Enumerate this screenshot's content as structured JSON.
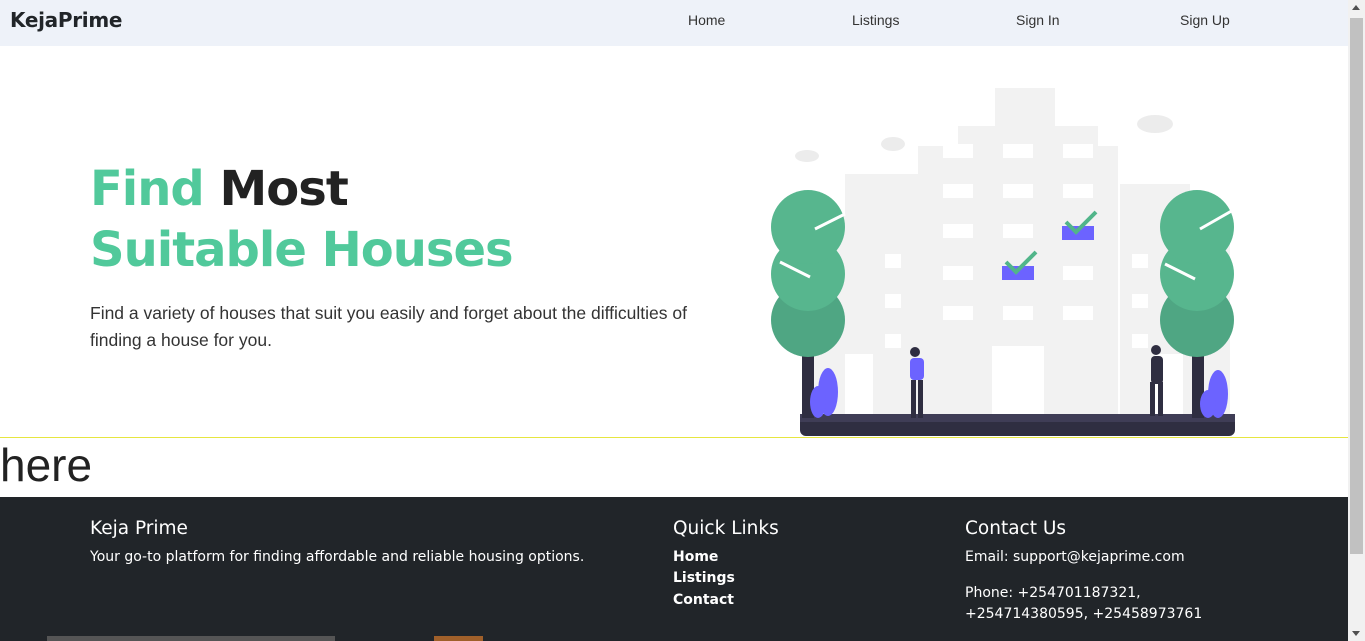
{
  "navbar": {
    "brand": "KejaPrime",
    "links": [
      "Home",
      "Listings",
      "Sign In",
      "Sign Up"
    ]
  },
  "hero": {
    "title_word1": "Find",
    "title_word2": "Most",
    "title_line2": "Suitable Houses",
    "description": "Find a variety of houses that suit you easily and forget about the difficulties of finding a house for you."
  },
  "filler_text": "here",
  "footer": {
    "about_title": "Keja Prime",
    "about_text": "Your go-to platform for finding affordable and reliable housing options.",
    "quick_links_title": "Quick Links",
    "quick_links": [
      "Home",
      "Listings",
      "Contact"
    ],
    "contact_title": "Contact Us",
    "email": "Email: support@kejaprime.com",
    "phone_line1": "Phone: +254701187321,",
    "phone_line2": "+254714380595, +25458973761"
  },
  "colors": {
    "accent_green": "#51c99b",
    "nav_bg": "#eef2f9",
    "footer_bg": "#212529",
    "illustration_purple": "#6c63ff"
  }
}
